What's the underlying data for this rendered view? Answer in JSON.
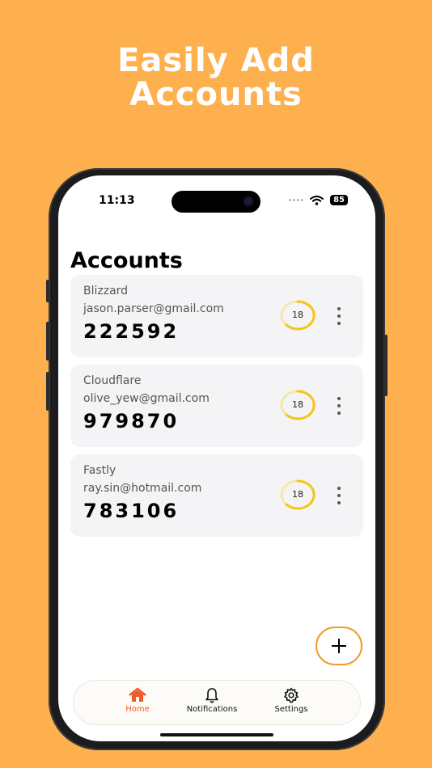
{
  "headline": {
    "line1": "Easily Add",
    "line2": "Accounts"
  },
  "status_bar": {
    "time": "11:13",
    "battery": "85"
  },
  "page": {
    "title": "Accounts"
  },
  "accounts": [
    {
      "service": "Blizzard",
      "email": "jason.parser@gmail.com",
      "code": "222592",
      "timer": "18"
    },
    {
      "service": "Cloudflare",
      "email": "olive_yew@gmail.com",
      "code": "979870",
      "timer": "18"
    },
    {
      "service": "Fastly",
      "email": "ray.sin@hotmail.com",
      "code": "783106",
      "timer": "18"
    }
  ],
  "tabs": [
    {
      "label": "Home",
      "icon": "home-icon",
      "active": true
    },
    {
      "label": "Notifications",
      "icon": "bell-icon",
      "active": false
    },
    {
      "label": "Settings",
      "icon": "gear-icon",
      "active": false
    }
  ],
  "colors": {
    "background": "#FDB04D",
    "accent": "#F05A28",
    "timer": "#F5C518",
    "fab_border": "#F39A2A"
  }
}
